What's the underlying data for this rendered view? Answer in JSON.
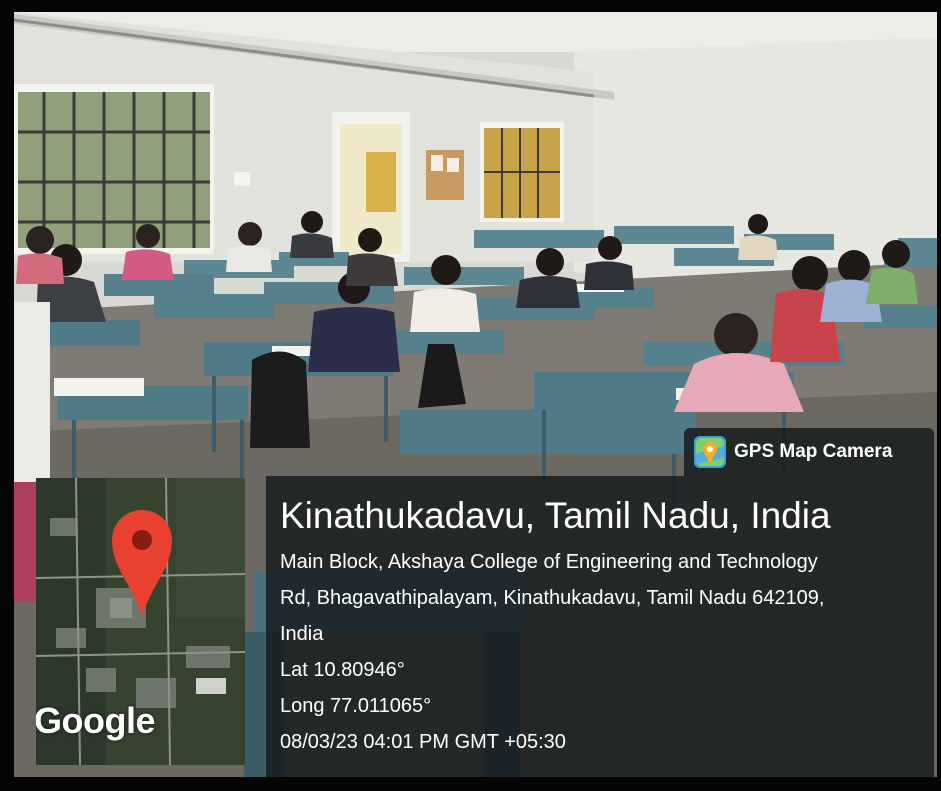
{
  "overlay": {
    "app_label": "GPS Map Camera",
    "location_title": "Kinathukadavu, Tamil Nadu, India",
    "address_line_1": "Main Block, Akshaya College of Engineering and Technology",
    "address_line_2": "Rd, Bhagavathipalayam, Kinathukadavu, Tamil Nadu 642109,",
    "address_line_3": "India",
    "latitude": "Lat 10.80946°",
    "longitude": "Long 77.011065°",
    "timestamp": "08/03/23 04:01 PM GMT +05:30"
  },
  "map": {
    "provider_logo": "Google",
    "marker_icon": "map-pin-icon"
  },
  "icons": {
    "app_icon": "gps-map-camera-icon"
  },
  "colors": {
    "marker_red": "#e8412f",
    "overlay_bg": "#14181a",
    "desk_blue": "#4f7a86",
    "wall": "#e4e4df"
  }
}
